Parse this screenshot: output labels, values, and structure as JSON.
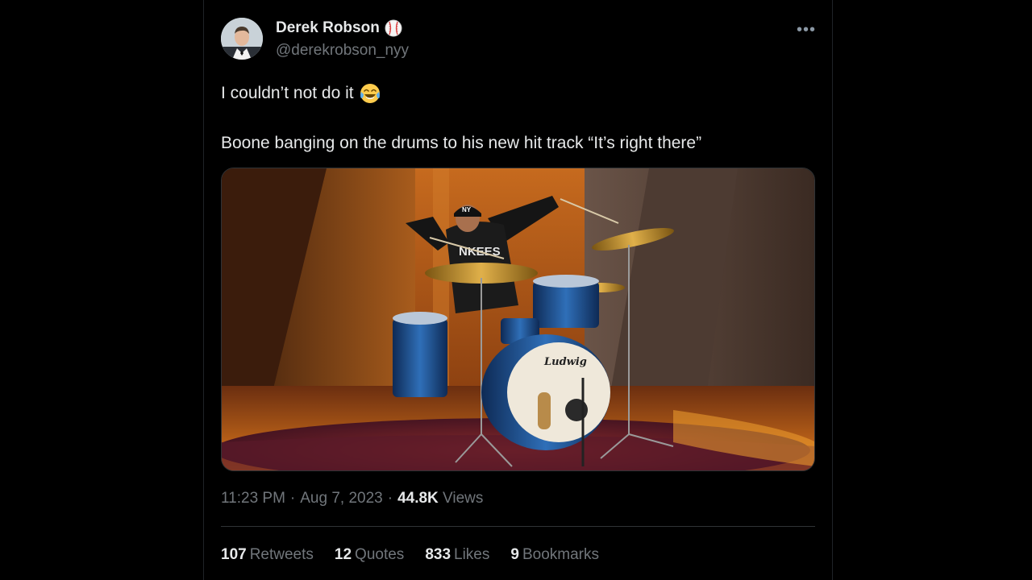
{
  "author": {
    "name": "Derek Robson",
    "handle": "@derekrobson_nyy",
    "badge_icon": "baseball-icon"
  },
  "more_icon": "more-horizontal-icon",
  "text": {
    "line1": "I couldn’t not do it",
    "line1_emoji": "tears-of-joy-emoji",
    "line2": "Boone banging on the drums to his new hit track “It’s right there”"
  },
  "media": {
    "cap_logo": "NY",
    "shirt_text": "NKEES",
    "drum_brand": "Ludwig"
  },
  "meta": {
    "time": "11:23 PM",
    "sep1": "·",
    "date": "Aug 7, 2023",
    "sep2": "·",
    "views_count": "44.8K",
    "views_label": "Views"
  },
  "stats": {
    "retweets_count": "107",
    "retweets_label": "Retweets",
    "quotes_count": "12",
    "quotes_label": "Quotes",
    "likes_count": "833",
    "likes_label": "Likes",
    "bookmarks_count": "9",
    "bookmarks_label": "Bookmarks"
  },
  "colors": {
    "background": "#000000",
    "text_primary": "#e7e9ea",
    "text_secondary": "#71767b",
    "border": "#2f3336"
  }
}
